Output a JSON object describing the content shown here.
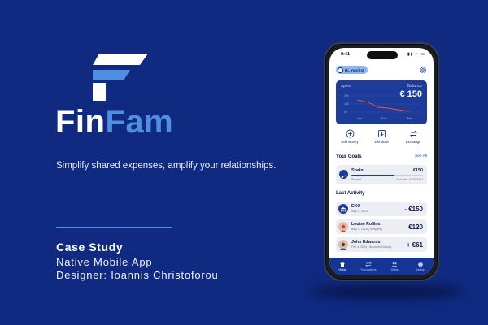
{
  "brand": {
    "part1": "Fin",
    "part2": "Fam",
    "accent": "#4f8ee0",
    "background": "#0f2a80"
  },
  "tagline": "Simplify shared expenses, amplify your relationships.",
  "case_study": {
    "title": "Case Study",
    "line1": "Native Mobile App",
    "line2": "Designer: Ioannis Christoforou"
  },
  "phone": {
    "status_time": "9:41",
    "greeting": "Hi, Yannis!",
    "balance_card": {
      "spent_label": "Spent",
      "balance_label": "Balance",
      "balance_value": "€ 150",
      "y_ticks": [
        "200",
        "100",
        "50"
      ],
      "x_ticks": [
        "Jan",
        "Feb",
        "Mar"
      ]
    },
    "actions": [
      {
        "label": "Add Money",
        "icon": "plus-circle-icon"
      },
      {
        "label": "Withdraw",
        "icon": "withdraw-icon"
      },
      {
        "label": "Exchange",
        "icon": "exchange-icon"
      }
    ],
    "goals": {
      "title": "Your Goals",
      "see_all": "See All",
      "item": {
        "name": "Spain",
        "amount": "€150",
        "sub": "Started",
        "end": "End date: 07/08/2024",
        "progress": 0.6
      }
    },
    "activity": {
      "title": "Last Activity",
      "items": [
        {
          "name": "EKO",
          "sub": "May 7, 2024",
          "amount": "- €150"
        },
        {
          "name": "Louise Rollins",
          "sub": "May 7, 2024 | Shopping",
          "amount": "€120"
        },
        {
          "name": "John Edwards",
          "sub": "Feb 3, 2024 | Borrowed Money",
          "amount": "+ €61"
        }
      ]
    },
    "tabs": [
      {
        "label": "Home",
        "icon": "home-icon",
        "active": true
      },
      {
        "label": "Transactions",
        "icon": "transactions-icon",
        "active": false
      },
      {
        "label": "Debts",
        "icon": "debts-icon",
        "active": false
      },
      {
        "label": "Savings",
        "icon": "savings-icon",
        "active": false
      }
    ]
  }
}
